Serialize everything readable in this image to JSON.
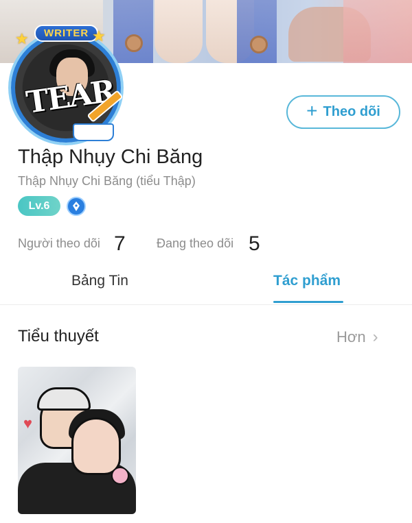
{
  "profile": {
    "avatar_badge": "WRITER",
    "avatar_art_text": "TEAR",
    "display_name": "Thập Nhụy Chi Băng",
    "alias": "Thập Nhụy Chi Băng (tiểu Thập)",
    "level": "Lv.6",
    "follow_icon": "+",
    "follow_label": "Theo dõi"
  },
  "stats": {
    "followers_label": "Người theo dõi",
    "followers_value": "7",
    "following_label": "Đang theo dõi",
    "following_value": "5"
  },
  "tabs": {
    "news": "Bảng Tin",
    "works": "Tác phẩm"
  },
  "section": {
    "title": "Tiểu thuyết",
    "more_label": "Hơn",
    "more_icon": "›"
  },
  "colors": {
    "accent": "#2f9ed0",
    "level_badge": "#4ac6c4",
    "muted_text": "#8c8c8c"
  },
  "icons": {
    "follow": "plus-icon",
    "pen_badge": "pen-badge-icon",
    "more": "chevron-right-icon"
  }
}
